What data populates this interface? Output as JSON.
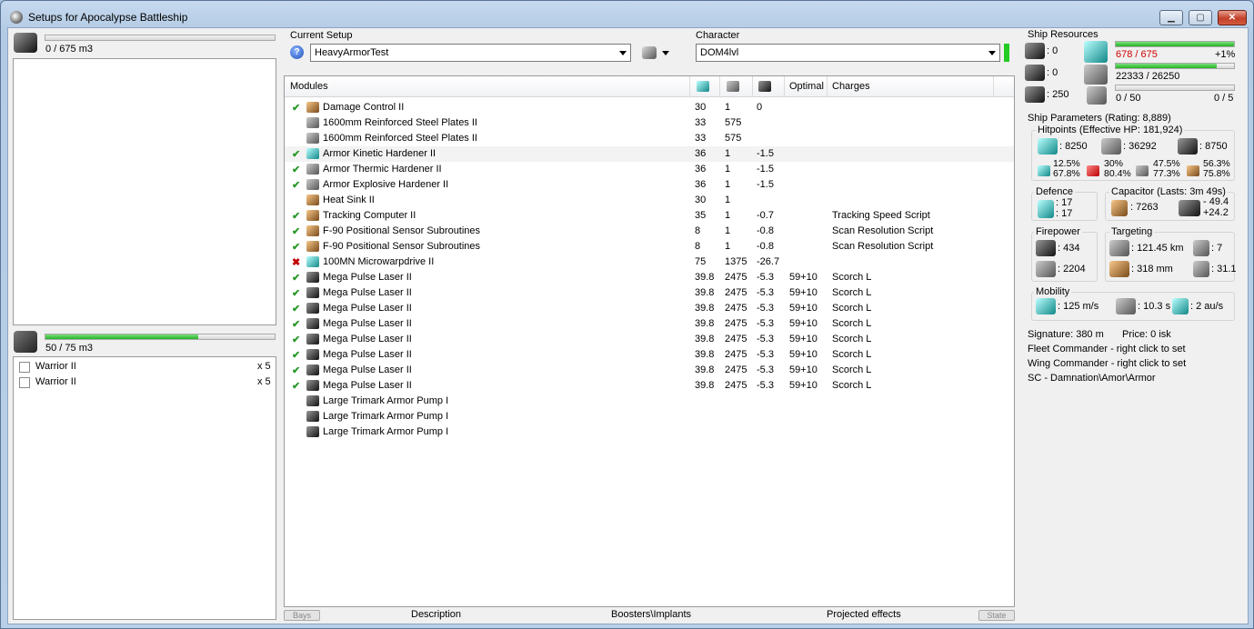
{
  "window": {
    "title": "Setups for Apocalypse Battleship",
    "minimize": "▁",
    "maximize": "▢",
    "close": "✕"
  },
  "cargo": {
    "capacity_text": "0 / 675 m3",
    "fill_fraction": 0.0
  },
  "drones": {
    "capacity_text": "50 / 75 m3",
    "fill_fraction": 0.6667,
    "items": [
      {
        "name": "Warrior II",
        "qty": "x 5"
      },
      {
        "name": "Warrior II",
        "qty": "x 5"
      }
    ]
  },
  "setup": {
    "label": "Current Setup",
    "value": "HeavyArmorTest"
  },
  "character": {
    "label": "Character",
    "value": "DOM4lvl"
  },
  "modules": {
    "headers": {
      "name": "Modules",
      "optimal": "Optimal",
      "charges": "Charges"
    },
    "rows": [
      {
        "state": "check",
        "icon": "ic-copper",
        "name": "Damage Control II",
        "cpu": "30",
        "pg": "1",
        "cap": "0",
        "optimal": "",
        "charges": ""
      },
      {
        "state": "",
        "icon": "ic-gray",
        "name": "1600mm Reinforced Steel Plates II",
        "cpu": "33",
        "pg": "575",
        "cap": "",
        "optimal": "",
        "charges": ""
      },
      {
        "state": "",
        "icon": "ic-gray",
        "name": "1600mm Reinforced Steel Plates II",
        "cpu": "33",
        "pg": "575",
        "cap": "",
        "optimal": "",
        "charges": ""
      },
      {
        "state": "check",
        "icon": "ic-cyan",
        "name": "Armor Kinetic Hardener II",
        "cpu": "36",
        "pg": "1",
        "cap": "-1.5",
        "optimal": "",
        "charges": "",
        "selected": true
      },
      {
        "state": "check",
        "icon": "ic-gray",
        "name": "Armor Thermic Hardener II",
        "cpu": "36",
        "pg": "1",
        "cap": "-1.5",
        "optimal": "",
        "charges": ""
      },
      {
        "state": "check",
        "icon": "ic-gray",
        "name": "Armor Explosive Hardener II",
        "cpu": "36",
        "pg": "1",
        "cap": "-1.5",
        "optimal": "",
        "charges": ""
      },
      {
        "state": "",
        "icon": "ic-copper",
        "name": "Heat Sink II",
        "cpu": "30",
        "pg": "1",
        "cap": "",
        "optimal": "",
        "charges": ""
      },
      {
        "state": "check",
        "icon": "ic-copper",
        "name": "Tracking Computer II",
        "cpu": "35",
        "pg": "1",
        "cap": "-0.7",
        "optimal": "",
        "charges": "Tracking Speed Script"
      },
      {
        "state": "check",
        "icon": "ic-copper",
        "name": "F-90 Positional Sensor Subroutines",
        "cpu": "8",
        "pg": "1",
        "cap": "-0.8",
        "optimal": "",
        "charges": "Scan Resolution Script"
      },
      {
        "state": "check",
        "icon": "ic-copper",
        "name": "F-90 Positional Sensor Subroutines",
        "cpu": "8",
        "pg": "1",
        "cap": "-0.8",
        "optimal": "",
        "charges": "Scan Resolution Script"
      },
      {
        "state": "x",
        "icon": "ic-cyan",
        "name": "100MN Microwarpdrive II",
        "cpu": "75",
        "pg": "1375",
        "cap": "-26.7",
        "optimal": "",
        "charges": ""
      },
      {
        "state": "check",
        "icon": "ic-dark",
        "name": "Mega Pulse Laser II",
        "cpu": "39.8",
        "pg": "2475",
        "cap": "-5.3",
        "optimal": "59+10",
        "charges": "Scorch L"
      },
      {
        "state": "check",
        "icon": "ic-dark",
        "name": "Mega Pulse Laser II",
        "cpu": "39.8",
        "pg": "2475",
        "cap": "-5.3",
        "optimal": "59+10",
        "charges": "Scorch L"
      },
      {
        "state": "check",
        "icon": "ic-dark",
        "name": "Mega Pulse Laser II",
        "cpu": "39.8",
        "pg": "2475",
        "cap": "-5.3",
        "optimal": "59+10",
        "charges": "Scorch L"
      },
      {
        "state": "check",
        "icon": "ic-dark",
        "name": "Mega Pulse Laser II",
        "cpu": "39.8",
        "pg": "2475",
        "cap": "-5.3",
        "optimal": "59+10",
        "charges": "Scorch L"
      },
      {
        "state": "check",
        "icon": "ic-dark",
        "name": "Mega Pulse Laser II",
        "cpu": "39.8",
        "pg": "2475",
        "cap": "-5.3",
        "optimal": "59+10",
        "charges": "Scorch L"
      },
      {
        "state": "check",
        "icon": "ic-dark",
        "name": "Mega Pulse Laser II",
        "cpu": "39.8",
        "pg": "2475",
        "cap": "-5.3",
        "optimal": "59+10",
        "charges": "Scorch L"
      },
      {
        "state": "check",
        "icon": "ic-dark",
        "name": "Mega Pulse Laser II",
        "cpu": "39.8",
        "pg": "2475",
        "cap": "-5.3",
        "optimal": "59+10",
        "charges": "Scorch L"
      },
      {
        "state": "check",
        "icon": "ic-dark",
        "name": "Mega Pulse Laser II",
        "cpu": "39.8",
        "pg": "2475",
        "cap": "-5.3",
        "optimal": "59+10",
        "charges": "Scorch L"
      },
      {
        "state": "",
        "icon": "ic-dark",
        "name": "Large Trimark Armor Pump I",
        "cpu": "",
        "pg": "",
        "cap": "",
        "optimal": "",
        "charges": ""
      },
      {
        "state": "",
        "icon": "ic-dark",
        "name": "Large Trimark Armor Pump I",
        "cpu": "",
        "pg": "",
        "cap": "",
        "optimal": "",
        "charges": ""
      },
      {
        "state": "",
        "icon": "ic-dark",
        "name": "Large Trimark Armor Pump I",
        "cpu": "",
        "pg": "",
        "cap": "",
        "optimal": "",
        "charges": ""
      }
    ]
  },
  "bottom_tabs": {
    "bays": "Bays",
    "description": "Description",
    "boosters": "Boosters\\Implants",
    "projected": "Projected effects",
    "state": "State"
  },
  "resources": {
    "title": "Ship Resources",
    "turrets": ": 0",
    "launchers": ": 0",
    "calibration": ": 250",
    "cpu_text": "678 / 675",
    "cpu_pct": "+1%",
    "cpu_fraction": 1.0,
    "pg_text": "22333 / 26250",
    "pg_fraction": 0.851,
    "drone_bw_text": "0 / 50",
    "drone_active": "0 / 5",
    "drone_bw_fraction": 0.0
  },
  "parameters": {
    "title": "Ship Parameters (Rating: 8,889)",
    "hitpoints": {
      "title": "Hitpoints (Effective HP: 181,924)",
      "shield": ": 8250",
      "armor": ": 36292",
      "structure": ": 8750",
      "resist_em": [
        "12.5%",
        "67.8%"
      ],
      "resist_thermal": [
        "30%",
        "80.4%"
      ],
      "resist_kinetic": [
        "47.5%",
        "77.3%"
      ],
      "resist_explosive": [
        "56.3%",
        "75.8%"
      ]
    },
    "defence": {
      "title": "Defence",
      "top": ": 17",
      "bottom": ": 17"
    },
    "capacitor": {
      "title": "Capacitor (Lasts: 3m 49s)",
      "amount": ": 7263",
      "delta_top": "- 49.4",
      "delta_bottom": "+24.2"
    },
    "firepower": {
      "title": "Firepower",
      "turret": ": 434",
      "drone": ": 2204"
    },
    "targeting": {
      "title": "Targeting",
      "range": ": 121.45 km",
      "targets": ": 7",
      "scan_res": ": 318 mm",
      "sensor": ": 31.1"
    },
    "mobility": {
      "title": "Mobility",
      "speed": ": 125 m/s",
      "align": ": 10.3 s",
      "warp": ": 2 au/s"
    }
  },
  "info": {
    "signature": "Signature: 380 m",
    "price": "Price: 0 isk",
    "fleet": "Fleet Commander - right click to set",
    "wing": "Wing Commander - right click to set",
    "sc": "SC - Damnation\\Amor\\Armor"
  }
}
